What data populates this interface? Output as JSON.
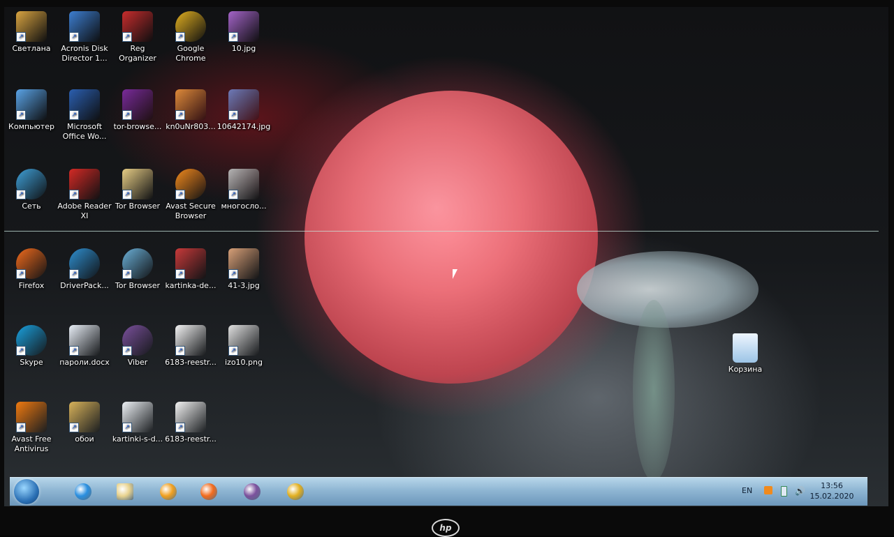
{
  "desktop": {
    "icons": [
      {
        "name": "desktop-icon-svetlana",
        "label": "Светлана",
        "icon": "folder-user-icon",
        "color": "#d9a441"
      },
      {
        "name": "desktop-icon-acronis",
        "label": "Acronis Disk Director 1...",
        "icon": "disk-tool-icon",
        "color": "#3d7ed0"
      },
      {
        "name": "desktop-icon-reg-organizer",
        "label": "Reg Organizer",
        "icon": "reg-organizer-icon",
        "color": "#c72d2d"
      },
      {
        "name": "desktop-icon-google-chrome",
        "label": "Google Chrome",
        "icon": "chrome-icon",
        "color": "#e2b021"
      },
      {
        "name": "desktop-icon-10-jpg",
        "label": "10.jpg",
        "icon": "image-thumbnail-icon",
        "color": "#a464c8"
      },
      {
        "name": "desktop-icon-computer",
        "label": "Компьютер",
        "icon": "computer-icon",
        "color": "#5aa3e6"
      },
      {
        "name": "desktop-icon-ms-word",
        "label": "Microsoft Office Wo...",
        "icon": "word-icon",
        "color": "#2b5fb0"
      },
      {
        "name": "desktop-icon-tor-browse-archive",
        "label": "tor-browse...",
        "icon": "winrar-icon",
        "color": "#7a2b9a"
      },
      {
        "name": "desktop-icon-kn0unr803",
        "label": "kn0uNr803...",
        "icon": "image-thumbnail-icon",
        "color": "#e08a3a"
      },
      {
        "name": "desktop-icon-10642174-jpg",
        "label": "10642174.jpg",
        "icon": "image-thumbnail-icon",
        "color": "#6e7ab8"
      },
      {
        "name": "desktop-icon-network",
        "label": "Сеть",
        "icon": "network-globe-icon",
        "color": "#3fa0d8"
      },
      {
        "name": "desktop-icon-adobe-reader",
        "label": "Adobe Reader XI",
        "icon": "adobe-reader-icon",
        "color": "#d42a25"
      },
      {
        "name": "desktop-icon-tor-browser-folder",
        "label": "Tor Browser",
        "icon": "folder-icon",
        "color": "#e7cd85"
      },
      {
        "name": "desktop-icon-avast-secure-browser",
        "label": "Avast Secure Browser",
        "icon": "avast-browser-icon",
        "color": "#f08a1d"
      },
      {
        "name": "desktop-icon-mnogoslo",
        "label": "многосло...",
        "icon": "image-thumbnail-icon",
        "color": "#b5b5b5"
      },
      {
        "name": "desktop-icon-firefox",
        "label": "Firefox",
        "icon": "firefox-icon",
        "color": "#f26b1d"
      },
      {
        "name": "desktop-icon-driverpack",
        "label": "DriverPack...",
        "icon": "driverpack-icon",
        "color": "#2f8fd0"
      },
      {
        "name": "desktop-icon-tor-browser-app",
        "label": "Tor Browser",
        "icon": "tor-globe-icon",
        "color": "#6bb0d8"
      },
      {
        "name": "desktop-icon-kartinka-de",
        "label": "kartinka-de...",
        "icon": "image-thumbnail-icon",
        "color": "#c83a3a"
      },
      {
        "name": "desktop-icon-41-3-jpg",
        "label": "41-3.jpg",
        "icon": "image-thumbnail-icon",
        "color": "#d8a078"
      },
      {
        "name": "desktop-icon-skype",
        "label": "Skype",
        "icon": "skype-icon",
        "color": "#1aa2e0"
      },
      {
        "name": "desktop-icon-paroli-docx",
        "label": "пароли.docx",
        "icon": "document-icon",
        "color": "#e8eef6"
      },
      {
        "name": "desktop-icon-viber",
        "label": "Viber",
        "icon": "viber-icon",
        "color": "#7b519d"
      },
      {
        "name": "desktop-icon-6183-reestr-1",
        "label": "6183-reestr...",
        "icon": "pdf-document-icon",
        "color": "#f3f3f3"
      },
      {
        "name": "desktop-icon-izo10-png",
        "label": "izo10.png",
        "icon": "image-thumbnail-icon",
        "color": "#e0e0e0"
      },
      {
        "name": "desktop-icon-avast-free-antivirus",
        "label": "Avast Free Antivirus",
        "icon": "avast-icon",
        "color": "#f07a10"
      },
      {
        "name": "desktop-icon-oboi",
        "label": "обои",
        "icon": "folder-icon",
        "color": "#d8b25a"
      },
      {
        "name": "desktop-icon-kartinki-s-d",
        "label": "kartinki-s-d...",
        "icon": "image-thumbnail-icon",
        "color": "#eef2f6"
      },
      {
        "name": "desktop-icon-6183-reestr-2",
        "label": "6183-reestr...",
        "icon": "pdf-document-icon",
        "color": "#f3f3f3"
      }
    ],
    "recycle_bin": {
      "label": "Корзина",
      "icon": "recycle-bin-icon",
      "color": "#cfe2f2"
    }
  },
  "taskbar": {
    "start_icon": "windows-start-icon",
    "pinned": [
      {
        "name": "taskbar-internet-explorer",
        "icon": "internet-explorer-icon",
        "color": "#2a8fe0"
      },
      {
        "name": "taskbar-file-explorer",
        "icon": "folder-icon",
        "color": "#e9d38f"
      },
      {
        "name": "taskbar-media-player",
        "icon": "media-player-icon",
        "color": "#f0a020"
      },
      {
        "name": "taskbar-firefox",
        "icon": "firefox-icon",
        "color": "#f26b1d"
      },
      {
        "name": "taskbar-viber",
        "icon": "viber-icon",
        "color": "#7b519d"
      },
      {
        "name": "taskbar-chrome",
        "icon": "chrome-icon",
        "color": "#e2b021"
      }
    ],
    "tray": {
      "language": "EN",
      "time": "13:56",
      "date": "15.02.2020"
    }
  },
  "brand": {
    "logo_text": "hp"
  }
}
